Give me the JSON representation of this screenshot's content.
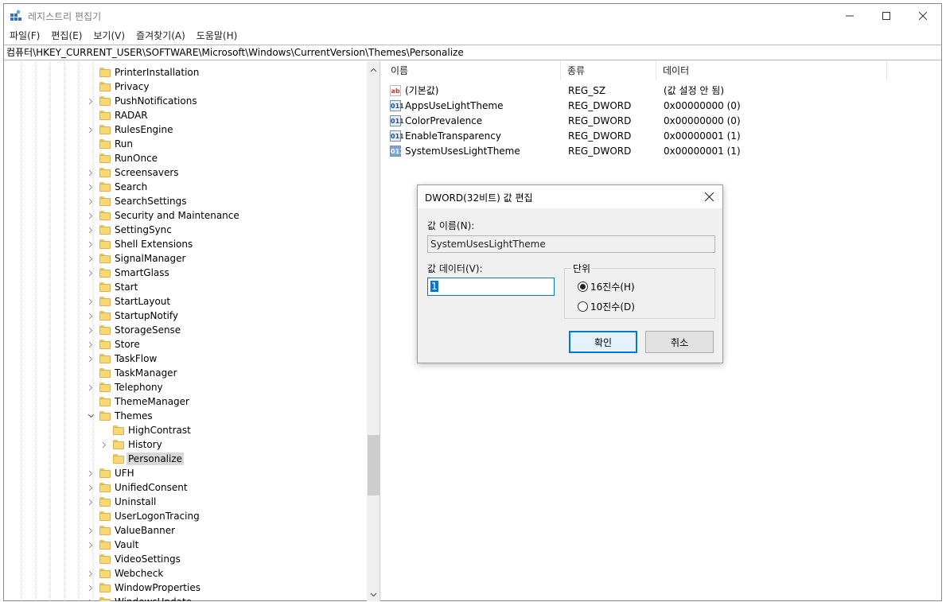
{
  "window": {
    "title": "레지스트리 편집기",
    "minimize_glyph": "—",
    "maximize_glyph": "☐",
    "close_glyph": "✕"
  },
  "menu": [
    "파일(F)",
    "편집(E)",
    "보기(V)",
    "즐겨찾기(A)",
    "도움말(H)"
  ],
  "address": "컴퓨터\\HKEY_CURRENT_USER\\SOFTWARE\\Microsoft\\Windows\\CurrentVersion\\Themes\\Personalize",
  "tree": [
    {
      "label": "PrinterInstallation",
      "expander": "",
      "level": 0
    },
    {
      "label": "Privacy",
      "expander": "",
      "level": 0
    },
    {
      "label": "PushNotifications",
      "expander": "collapsed",
      "level": 0
    },
    {
      "label": "RADAR",
      "expander": "",
      "level": 0
    },
    {
      "label": "RulesEngine",
      "expander": "collapsed",
      "level": 0
    },
    {
      "label": "Run",
      "expander": "",
      "level": 0
    },
    {
      "label": "RunOnce",
      "expander": "",
      "level": 0
    },
    {
      "label": "Screensavers",
      "expander": "collapsed",
      "level": 0
    },
    {
      "label": "Search",
      "expander": "collapsed",
      "level": 0
    },
    {
      "label": "SearchSettings",
      "expander": "collapsed",
      "level": 0
    },
    {
      "label": "Security and Maintenance",
      "expander": "collapsed",
      "level": 0
    },
    {
      "label": "SettingSync",
      "expander": "collapsed",
      "level": 0
    },
    {
      "label": "Shell Extensions",
      "expander": "collapsed",
      "level": 0
    },
    {
      "label": "SignalManager",
      "expander": "collapsed",
      "level": 0
    },
    {
      "label": "SmartGlass",
      "expander": "collapsed",
      "level": 0
    },
    {
      "label": "Start",
      "expander": "",
      "level": 0
    },
    {
      "label": "StartLayout",
      "expander": "collapsed",
      "level": 0
    },
    {
      "label": "StartupNotify",
      "expander": "collapsed",
      "level": 0
    },
    {
      "label": "StorageSense",
      "expander": "collapsed",
      "level": 0
    },
    {
      "label": "Store",
      "expander": "collapsed",
      "level": 0
    },
    {
      "label": "TaskFlow",
      "expander": "collapsed",
      "level": 0
    },
    {
      "label": "TaskManager",
      "expander": "",
      "level": 0
    },
    {
      "label": "Telephony",
      "expander": "collapsed",
      "level": 0
    },
    {
      "label": "ThemeManager",
      "expander": "",
      "level": 0
    },
    {
      "label": "Themes",
      "expander": "expanded",
      "level": 0
    },
    {
      "label": "HighContrast",
      "expander": "",
      "level": 1
    },
    {
      "label": "History",
      "expander": "collapsed",
      "level": 1
    },
    {
      "label": "Personalize",
      "expander": "",
      "level": 1,
      "selected": true
    },
    {
      "label": "UFH",
      "expander": "collapsed",
      "level": 0
    },
    {
      "label": "UnifiedConsent",
      "expander": "collapsed",
      "level": 0
    },
    {
      "label": "Uninstall",
      "expander": "collapsed",
      "level": 0
    },
    {
      "label": "UserLogonTracing",
      "expander": "",
      "level": 0
    },
    {
      "label": "ValueBanner",
      "expander": "collapsed",
      "level": 0
    },
    {
      "label": "Vault",
      "expander": "collapsed",
      "level": 0
    },
    {
      "label": "VideoSettings",
      "expander": "",
      "level": 0
    },
    {
      "label": "Webcheck",
      "expander": "collapsed",
      "level": 0
    },
    {
      "label": "WindowProperties",
      "expander": "collapsed",
      "level": 0
    },
    {
      "label": "WindowsUpdate",
      "expander": "collapsed",
      "level": 0
    }
  ],
  "list": {
    "headers": [
      "이름",
      "종류",
      "데이터"
    ],
    "rows": [
      {
        "icon": "string-value-icon",
        "kind": "sz",
        "name": "(기본값)",
        "type": "REG_SZ",
        "data": "(값 설정 안 됨)"
      },
      {
        "icon": "dword-value-icon",
        "kind": "dword",
        "name": "AppsUseLightTheme",
        "type": "REG_DWORD",
        "data": "0x00000000 (0)"
      },
      {
        "icon": "dword-value-icon",
        "kind": "dword",
        "name": "ColorPrevalence",
        "type": "REG_DWORD",
        "data": "0x00000000 (0)"
      },
      {
        "icon": "dword-value-icon",
        "kind": "dword",
        "name": "EnableTransparency",
        "type": "REG_DWORD",
        "data": "0x00000001 (1)"
      },
      {
        "icon": "dword-value-icon",
        "kind": "dword-sel",
        "name": "SystemUsesLightTheme",
        "type": "REG_DWORD",
        "data": "0x00000001 (1)"
      }
    ]
  },
  "dialog": {
    "title": "DWORD(32비트) 값 편집",
    "name_label": "값 이름(N):",
    "name_value": "SystemUsesLightTheme",
    "data_label": "값 데이터(V):",
    "data_value": "1",
    "unit_label": "단위",
    "radio_hex": "16진수(H)",
    "radio_dec": "10진수(D)",
    "selected_base": "hex",
    "ok": "확인",
    "cancel": "취소"
  }
}
